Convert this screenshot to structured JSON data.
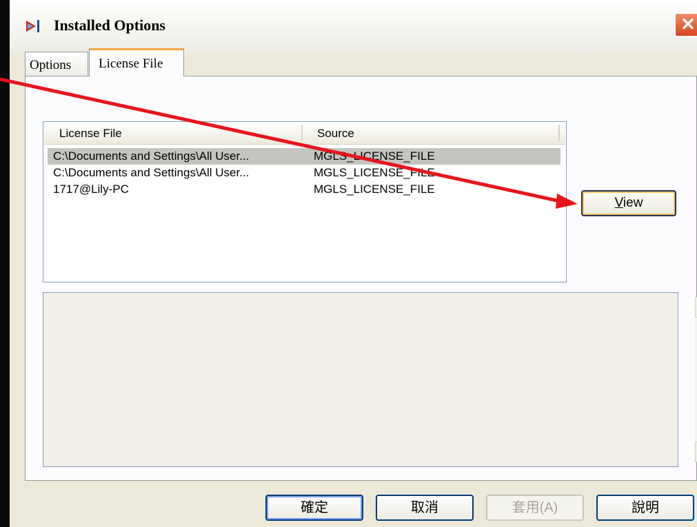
{
  "window": {
    "title": "Installed Options",
    "close_glyph": "✕"
  },
  "tabs": [
    {
      "label": "Options"
    },
    {
      "label": "License File"
    }
  ],
  "license_list": {
    "columns": [
      "License File",
      "Source"
    ],
    "rows": [
      {
        "license_file": "C:\\Documents and Settings\\All User...",
        "source": "MGLS_LICENSE_FILE"
      },
      {
        "license_file": "C:\\Documents and Settings\\All User...",
        "source": "MGLS_LICENSE_FILE"
      },
      {
        "license_file": "1717@Lily-PC",
        "source": "MGLS_LICENSE_FILE"
      }
    ]
  },
  "view_button": {
    "label_first": "V",
    "label_rest": "iew"
  },
  "scrollbar": {
    "up_glyph": "▲",
    "down_glyph": "▼"
  },
  "buttons": {
    "ok": "確定",
    "cancel": "取消",
    "apply": "套用(A)",
    "help": "說明"
  },
  "colors": {
    "annotation_arrow": "#e8141a",
    "tab_highlight": "#f3a63c"
  }
}
